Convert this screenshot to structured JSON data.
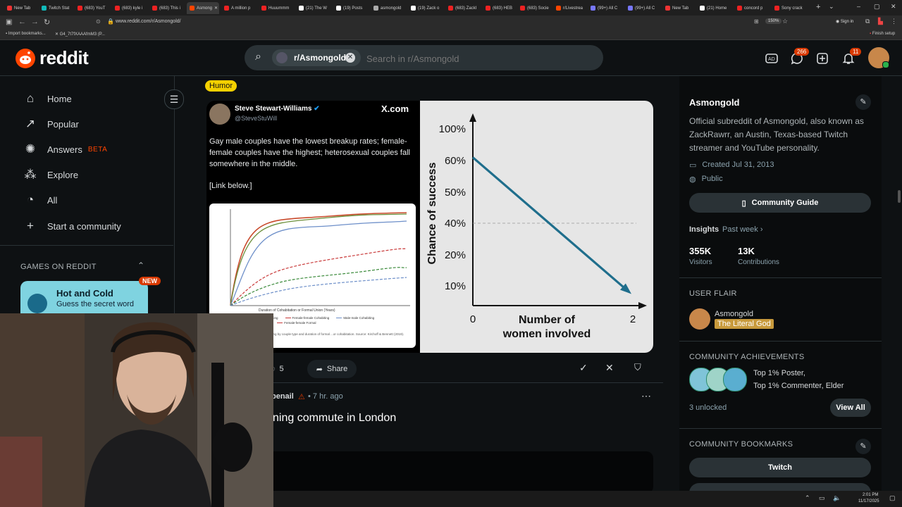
{
  "browser": {
    "tabs": [
      {
        "label": "New Tab",
        "color": "#e33"
      },
      {
        "label": "Twitch Stat",
        "color": "#1bb"
      },
      {
        "label": "(683) YouT",
        "color": "#e22"
      },
      {
        "label": "(683) kyle i",
        "color": "#e22"
      },
      {
        "label": "(683) This i",
        "color": "#e22"
      },
      {
        "label": "Asmong",
        "color": "#ff4500"
      },
      {
        "label": "A million p",
        "color": "#e22"
      },
      {
        "label": "Huuummm",
        "color": "#e22"
      },
      {
        "label": "(21) The W",
        "color": "#fff"
      },
      {
        "label": "(19) Posts",
        "color": "#fff"
      },
      {
        "label": "asmongold",
        "color": "#aaa"
      },
      {
        "label": "(19) Zack o",
        "color": "#fff"
      },
      {
        "label": "(683) ZackI",
        "color": "#e22"
      },
      {
        "label": "(683) HEB",
        "color": "#e22"
      },
      {
        "label": "(683) Socie",
        "color": "#e22"
      },
      {
        "label": "r/Livestrea",
        "color": "#ff4500"
      },
      {
        "label": "(99+) All C",
        "color": "#77f"
      },
      {
        "label": "(99+) All C",
        "color": "#77f"
      },
      {
        "label": "New Tab",
        "color": "#e33"
      },
      {
        "label": "(21) Home",
        "color": "#fff"
      },
      {
        "label": "concord p",
        "color": "#e22"
      },
      {
        "label": "Sony crack",
        "color": "#e22"
      }
    ],
    "url": "www.reddit.com/r/Asmongold/",
    "zoom": "150%",
    "sign_in": "Sign in",
    "bookmarks": [
      "Import bookmarks...",
      "G4_7t7fXAAAfmM3 (P..."
    ],
    "finish_setup": "Finish setup"
  },
  "header": {
    "logo_text": "reddit",
    "search_chip": "r/Asmongold",
    "search_placeholder": "Search in r/Asmongold",
    "chat_badge": "266",
    "notif_badge": "11"
  },
  "nav": {
    "items": [
      {
        "label": "Home",
        "icon": "home-icon"
      },
      {
        "label": "Popular",
        "icon": "popular-icon"
      },
      {
        "label": "Answers",
        "icon": "answers-icon",
        "badge": "BETA"
      },
      {
        "label": "Explore",
        "icon": "explore-icon"
      },
      {
        "label": "All",
        "icon": "all-icon"
      },
      {
        "label": "Start a community",
        "icon": "plus-icon"
      }
    ],
    "games_title": "GAMES ON REDDIT",
    "game": {
      "title": "Hot and Cold",
      "subtitle": "Guess the secret word",
      "badge": "NEW"
    }
  },
  "post": {
    "flair": "Humor",
    "tweet": {
      "author": "Steve Stewart-Williams",
      "handle": "@SteveStuWill",
      "source": "X.com",
      "text": "Gay male couples have the lowest breakup rates; female-female couples have the highest; heterosexual couples fall somewhere in the middle.",
      "link": "[Link below.]",
      "figure_xlabel": "Duration of Cohabitation or Formal Union (Years)",
      "figure_legend": [
        "Male-female Cohabiting",
        "Female-female Cohabiting",
        "Male-male Cohabiting",
        "Male-male Formal",
        "Female-female Formal"
      ],
      "figure_caption": "...ortion of unions dissolving by couple type and duration of formal ...or cohabitation. Source: Kirchoff & Bennett (2019)."
    },
    "comments": "5",
    "share": "Share"
  },
  "post2": {
    "author_partial": "benail",
    "time": "7 hr. ago",
    "title_partial": "ning commute in London"
  },
  "chart_data": {
    "type": "line",
    "title": "",
    "xlabel": "Number of women involved",
    "ylabel": "Chance of success",
    "x": [
      0,
      2
    ],
    "series": [
      {
        "values": [
          61,
          7
        ]
      }
    ],
    "ytick_labels": [
      "100%",
      "60%",
      "50%",
      "40%",
      "20%",
      "10%"
    ],
    "xtick_labels": [
      "0",
      "2"
    ],
    "reference_line_label": "40%",
    "line_color": "#1f6e8c"
  },
  "sidebar": {
    "name": "Asmongold",
    "description": "Official subreddit of Asmongold, also known as ZackRawrr, an Austin, Texas-based Twitch streamer and YouTube personality.",
    "created": "Created Jul 31, 2013",
    "visibility": "Public",
    "guide_button": "Community Guide",
    "insights_label": "Insights",
    "insights_period": "Past week",
    "stats": [
      {
        "value": "355K",
        "label": "Visitors"
      },
      {
        "value": "13K",
        "label": "Contributions"
      }
    ],
    "user_flair_title": "USER FLAIR",
    "flair_user": "Asmongold",
    "flair_tag": "The Literal God",
    "achievements_title": "COMMUNITY ACHIEVEMENTS",
    "achievements": [
      "Top 1% Poster,",
      "Top 1% Commenter, Elder"
    ],
    "unlocked": "3 unlocked",
    "view_all": "View All",
    "bookmarks_title": "COMMUNITY BOOKMARKS",
    "bookmark_button": "Twitch"
  },
  "taskbar": {
    "time": "2:01 PM",
    "date": "11/17/2025"
  }
}
